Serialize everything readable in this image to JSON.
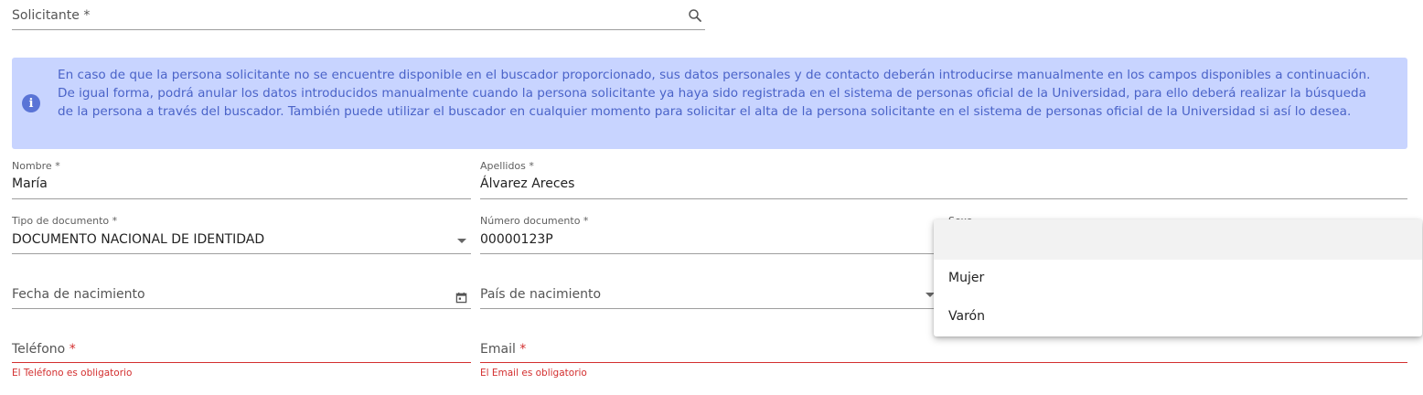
{
  "solicitante": {
    "label": "Solicitante *",
    "icon": "search-icon"
  },
  "alert": {
    "icon": "info-icon",
    "text": "En caso de que la persona solicitante no se encuentre disponible en el buscador proporcionado, sus datos personales y de contacto deberán introducirse manualmente en los campos disponibles a continuación. De igual forma, podrá anular los datos introducidos manualmente cuando la persona solicitante ya haya sido registrada en el sistema de personas oficial de la Universidad, para ello deberá realizar la búsqueda de la persona a través del buscador. También puede utilizar el buscador en cualquier momento para solicitar el alta de la persona solicitante en el sistema de personas oficial de la Universidad si así lo desea.",
    "bg_color": "#c8d4ff",
    "text_color": "#4a63c8"
  },
  "nombre": {
    "label": "Nombre *",
    "value": "María"
  },
  "apellidos": {
    "label": "Apellidos *",
    "value": "Álvarez Areces"
  },
  "tipo_documento": {
    "label": "Tipo de documento *",
    "value": "DOCUMENTO NACIONAL DE IDENTIDAD"
  },
  "numero_documento": {
    "label": "Número documento *",
    "value": "00000123P"
  },
  "sexo": {
    "label": "Sexo",
    "options": [
      "",
      "Mujer",
      "Varón"
    ]
  },
  "fecha_nacimiento": {
    "label": "Fecha de nacimiento",
    "icon": "calendar-icon"
  },
  "pais_nacimiento": {
    "label": "País de nacimiento"
  },
  "telefono": {
    "label": "Teléfono",
    "required_mark": "*",
    "error": "El Teléfono es obligatorio"
  },
  "email": {
    "label": "Email",
    "required_mark": "*",
    "error": "El Email es obligatorio"
  },
  "colors": {
    "error": "#d32f2f",
    "accent": "#5a74d6"
  }
}
